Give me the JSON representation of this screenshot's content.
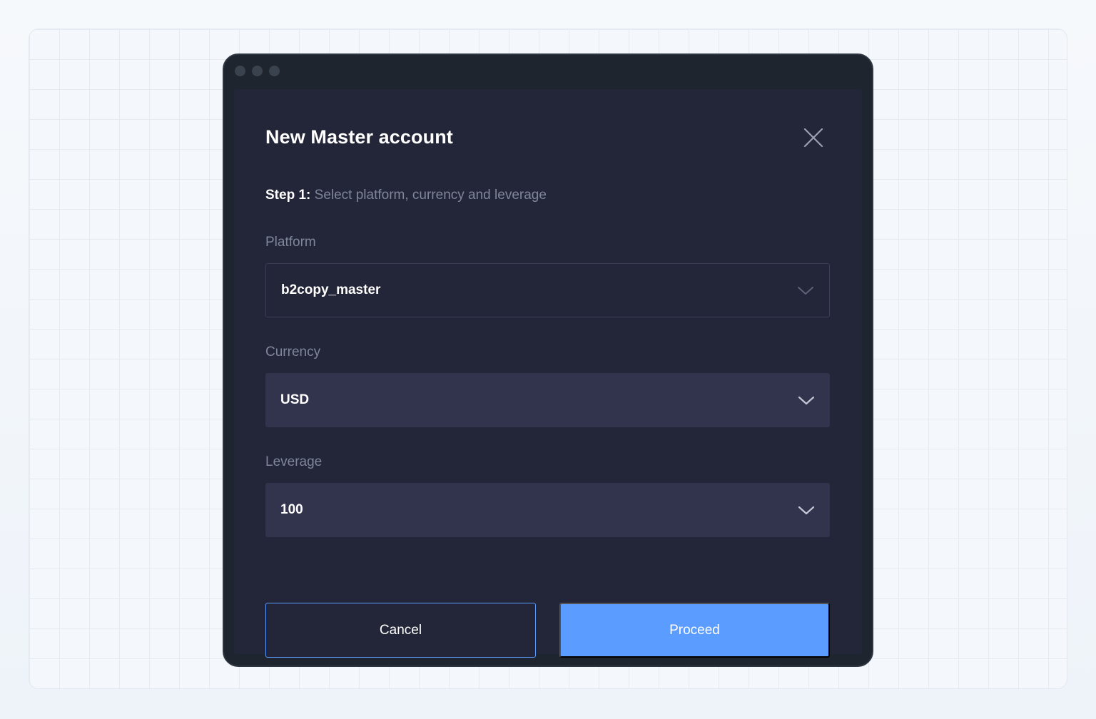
{
  "modal": {
    "title": "New Master account",
    "close_icon": "close-icon",
    "step": {
      "label": "Step 1:",
      "text": "Select platform, currency and leverage"
    },
    "fields": {
      "platform": {
        "label": "Platform",
        "value": "b2copy_master"
      },
      "currency": {
        "label": "Currency",
        "value": "USD"
      },
      "leverage": {
        "label": "Leverage",
        "value": "100"
      }
    },
    "buttons": {
      "cancel": "Cancel",
      "proceed": "Proceed"
    }
  },
  "colors": {
    "accent": "#5a9cff",
    "modal_bg": "#232638",
    "select_fill": "#32344d",
    "window_frame": "#1f252e",
    "muted_text": "#80869a"
  }
}
